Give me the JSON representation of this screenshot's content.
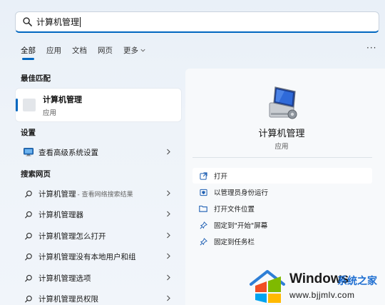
{
  "search": {
    "query": "计算机管理"
  },
  "tabs": [
    {
      "label": "全部",
      "active": true
    },
    {
      "label": "应用",
      "active": false
    },
    {
      "label": "文档",
      "active": false
    },
    {
      "label": "网页",
      "active": false
    },
    {
      "label": "更多",
      "active": false,
      "dropdown": true
    }
  ],
  "more_menu": {
    "label": "···"
  },
  "best_match": {
    "section_title": "最佳匹配",
    "name": "计算机管理",
    "type": "应用"
  },
  "settings": {
    "section_title": "设置",
    "items": [
      {
        "label": "查看高级系统设置"
      }
    ]
  },
  "web_search": {
    "section_title": "搜索网页",
    "items": [
      {
        "label": "计算机管理",
        "hint": "- 查看网络搜索结果"
      },
      {
        "label": "计算机管理器"
      },
      {
        "label": "计算机管理怎么打开"
      },
      {
        "label": "计算机管理没有本地用户和组"
      },
      {
        "label": "计算机管理选项"
      },
      {
        "label": "计算机管理员权限"
      }
    ]
  },
  "detail_panel": {
    "title": "计算机管理",
    "subtitle": "应用",
    "actions": [
      {
        "label": "打开",
        "icon": "open-icon"
      },
      {
        "label": "以管理员身份运行",
        "icon": "shield-run-icon"
      },
      {
        "label": "打开文件位置",
        "icon": "folder-icon"
      },
      {
        "label": "固定到\"开始\"屏幕",
        "icon": "pin-icon"
      },
      {
        "label": "固定到任务栏",
        "icon": "pin-icon"
      }
    ]
  },
  "watermark": {
    "brand": "Windows",
    "brand_cn": "系统之家",
    "url": "www.bjjmlv.com"
  },
  "colors": {
    "accent": "#0067c0",
    "background": "#eef3f9",
    "panel": "#f7f9fb"
  }
}
